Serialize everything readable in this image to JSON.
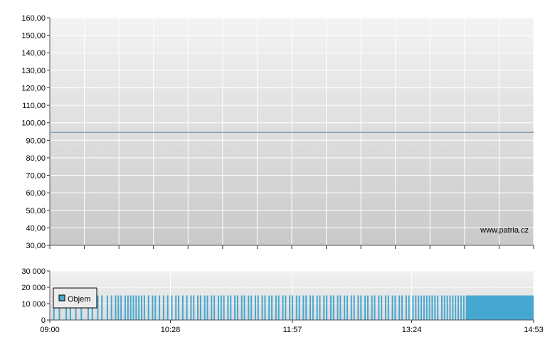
{
  "chart_data": [
    {
      "type": "line",
      "title": "",
      "xlabel": "",
      "ylabel": "",
      "ylim": [
        30,
        160
      ],
      "y_ticks": [
        "30,00",
        "40,00",
        "50,00",
        "60,00",
        "70,00",
        "80,00",
        "90,00",
        "100,00",
        "110,00",
        "120,00",
        "130,00",
        "140,00",
        "150,00",
        "160,00"
      ],
      "grid": true,
      "series": [
        {
          "x": [
            "09:00",
            "14:53"
          ],
          "values": [
            94.5,
            94.5
          ],
          "color": "#8a9ab8"
        }
      ],
      "watermark": "www.patria.cz"
    },
    {
      "type": "bar",
      "title": "",
      "xlabel": "",
      "ylabel": "",
      "ylim": [
        0,
        30000
      ],
      "y_ticks": [
        "0",
        "10 000",
        "20 000",
        "30 000"
      ],
      "x_ticks": [
        "09:00",
        "10:28",
        "11:57",
        "13:24",
        "14:53"
      ],
      "x_range": [
        "09:00",
        "14:53"
      ],
      "grid": true,
      "legend": {
        "position": "left",
        "entries": [
          {
            "label": "Objem",
            "color": "#46a7d0"
          }
        ]
      },
      "series": [
        {
          "name": "Objem",
          "color": "#46a7d0",
          "bar_value": 15000,
          "trade_times": [
            "09:03",
            "09:07",
            "09:12",
            "09:15",
            "09:19",
            "09:23",
            "09:28",
            "09:31",
            "09:35",
            "09:38",
            "09:42",
            "09:45",
            "09:48",
            "09:50",
            "09:52",
            "09:55",
            "09:57",
            "09:59",
            "10:01",
            "10:03",
            "10:05",
            "10:07",
            "10:09",
            "10:12",
            "10:15",
            "10:17",
            "10:20",
            "10:23",
            "10:26",
            "10:29",
            "10:32",
            "10:34",
            "10:37",
            "10:40",
            "10:43",
            "10:45",
            "10:48",
            "10:50",
            "10:53",
            "10:55",
            "10:58",
            "11:00",
            "11:03",
            "11:05",
            "11:07",
            "11:10",
            "11:12",
            "11:15",
            "11:17",
            "11:20",
            "11:22",
            "11:25",
            "11:27",
            "11:30",
            "11:32",
            "11:35",
            "11:37",
            "11:40",
            "11:42",
            "11:45",
            "11:47",
            "11:50",
            "11:52",
            "11:55",
            "11:57",
            "12:00",
            "12:02",
            "12:05",
            "12:07",
            "12:10",
            "12:12",
            "12:15",
            "12:17",
            "12:20",
            "12:22",
            "12:25",
            "12:27",
            "12:30",
            "12:32",
            "12:35",
            "12:37",
            "12:40",
            "12:42",
            "12:45",
            "12:47",
            "12:50",
            "12:52",
            "12:55",
            "12:57",
            "13:00",
            "13:02",
            "13:05",
            "13:07",
            "13:10",
            "13:12",
            "13:15",
            "13:17",
            "13:20",
            "13:22",
            "13:25",
            "13:27",
            "13:29",
            "13:31",
            "13:33",
            "13:35",
            "13:37",
            "13:39",
            "13:41",
            "13:43",
            "13:46",
            "13:48",
            "13:50",
            "13:52",
            "13:54",
            "13:56",
            "13:58",
            "14:00",
            "14:02",
            "14:04",
            "14:06",
            "14:08",
            "14:10",
            "14:12",
            "14:14",
            "14:16",
            "14:18",
            "14:20",
            "14:22",
            "14:24",
            "14:26",
            "14:28",
            "14:30",
            "14:32",
            "14:34",
            "14:36",
            "14:38",
            "14:40",
            "14:42",
            "14:44",
            "14:46",
            "14:48",
            "14:50",
            "14:52"
          ]
        }
      ]
    }
  ]
}
